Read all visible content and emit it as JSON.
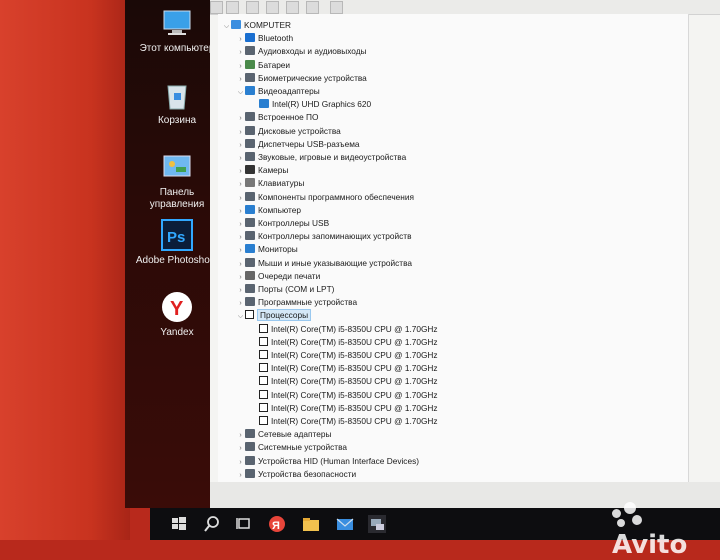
{
  "desktop": {
    "icons": [
      {
        "label": "Этот компьютер",
        "icon": "computer-icon"
      },
      {
        "label": "Корзина",
        "icon": "recycle-bin-icon"
      },
      {
        "label": "Панель управления",
        "icon": "control-panel-icon"
      },
      {
        "label": "Adobe Photosho...",
        "icon": "photoshop-icon"
      },
      {
        "label": "Yandex",
        "icon": "yandex-icon"
      }
    ]
  },
  "device_manager": {
    "root": "KOMPUTER",
    "categories": [
      {
        "label": "Bluetooth",
        "icon": "bluetooth-icon"
      },
      {
        "label": "Аудиовходы и аудиовыходы",
        "icon": "audio-icon"
      },
      {
        "label": "Батареи",
        "icon": "battery-icon"
      },
      {
        "label": "Биометрические устройства",
        "icon": "biometric-icon"
      },
      {
        "label": "Видеоадаптеры",
        "icon": "display-adapter-icon",
        "expanded": true,
        "children": [
          "Intel(R) UHD Graphics 620"
        ]
      },
      {
        "label": "Встроенное ПО",
        "icon": "firmware-icon"
      },
      {
        "label": "Дисковые устройства",
        "icon": "disk-icon"
      },
      {
        "label": "Диспетчеры USB-разъема",
        "icon": "usb-icon"
      },
      {
        "label": "Звуковые, игровые и видеоустройства",
        "icon": "sound-icon"
      },
      {
        "label": "Камеры",
        "icon": "camera-icon"
      },
      {
        "label": "Клавиатуры",
        "icon": "keyboard-icon"
      },
      {
        "label": "Компоненты программного обеспечения",
        "icon": "software-icon"
      },
      {
        "label": "Компьютер",
        "icon": "computer-icon"
      },
      {
        "label": "Контроллеры USB",
        "icon": "usb-controller-icon"
      },
      {
        "label": "Контроллеры запоминающих устройств",
        "icon": "storage-icon"
      },
      {
        "label": "Мониторы",
        "icon": "monitor-icon"
      },
      {
        "label": "Мыши и иные указывающие устройства",
        "icon": "mouse-icon"
      },
      {
        "label": "Очереди печати",
        "icon": "printer-icon"
      },
      {
        "label": "Порты (COM и LPT)",
        "icon": "port-icon"
      },
      {
        "label": "Программные устройства",
        "icon": "software-device-icon"
      },
      {
        "label": "Процессоры",
        "icon": "processor-icon",
        "expanded": true,
        "selected": true,
        "children": [
          "Intel(R) Core(TM) i5-8350U CPU @ 1.70GHz",
          "Intel(R) Core(TM) i5-8350U CPU @ 1.70GHz",
          "Intel(R) Core(TM) i5-8350U CPU @ 1.70GHz",
          "Intel(R) Core(TM) i5-8350U CPU @ 1.70GHz",
          "Intel(R) Core(TM) i5-8350U CPU @ 1.70GHz",
          "Intel(R) Core(TM) i5-8350U CPU @ 1.70GHz",
          "Intel(R) Core(TM) i5-8350U CPU @ 1.70GHz",
          "Intel(R) Core(TM) i5-8350U CPU @ 1.70GHz"
        ]
      },
      {
        "label": "Сетевые адаптеры",
        "icon": "network-icon"
      },
      {
        "label": "Системные устройства",
        "icon": "system-icon"
      },
      {
        "label": "Устройства HID (Human Interface Devices)",
        "icon": "hid-icon"
      },
      {
        "label": "Устройства безопасности",
        "icon": "security-icon"
      }
    ]
  },
  "taskbar": {
    "items": [
      "start-icon",
      "search-icon",
      "task-view-icon",
      "yandex-browser-icon",
      "file-explorer-icon",
      "mail-icon",
      "device-manager-icon"
    ]
  },
  "watermark": "Avito",
  "colors": {
    "selection": "#d5e8f7",
    "desktop_red": "#c8331f",
    "taskbar": "#0d0d10"
  }
}
